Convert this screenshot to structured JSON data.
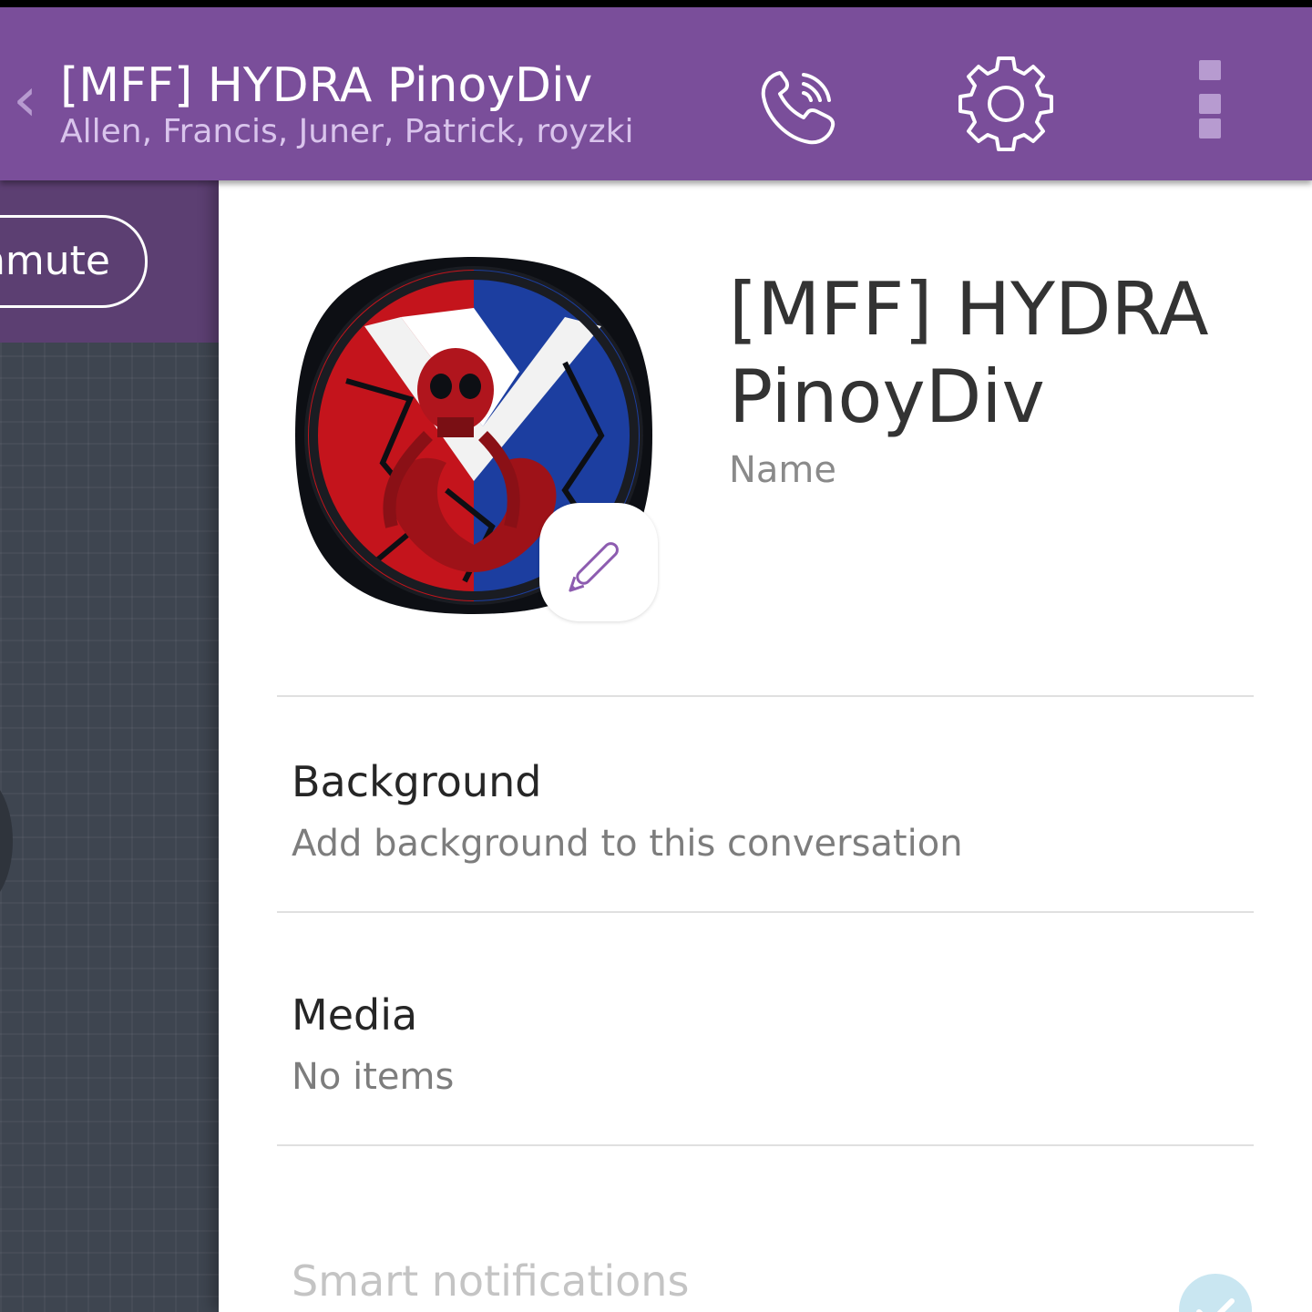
{
  "appbar": {
    "back_glyph": "‹",
    "title": "[MFF] HYDRA PinoyDiv",
    "members": "Allen, Francis, Juner, Patrick, royzki",
    "icons": [
      "back-chevron-icon",
      "viber-call-icon",
      "gear-icon",
      "overflow-menu-icon"
    ]
  },
  "chat": {
    "unmute_label": "Unmute"
  },
  "info": {
    "group_name": "[MFF] HYDRA PinoyDiv",
    "name_caption": "Name",
    "background_title": "Background",
    "background_sub": "Add background to this conversation",
    "media_title": "Media",
    "media_sub": "No items",
    "smart_notifications_title": "Smart notifications"
  },
  "colors": {
    "appbar": "#7a4e9a",
    "chat_header": "#5c3f72",
    "chat_bg": "#3e4550",
    "accent_icon": "#b79bd0",
    "pencil": "#8d5cb0"
  }
}
